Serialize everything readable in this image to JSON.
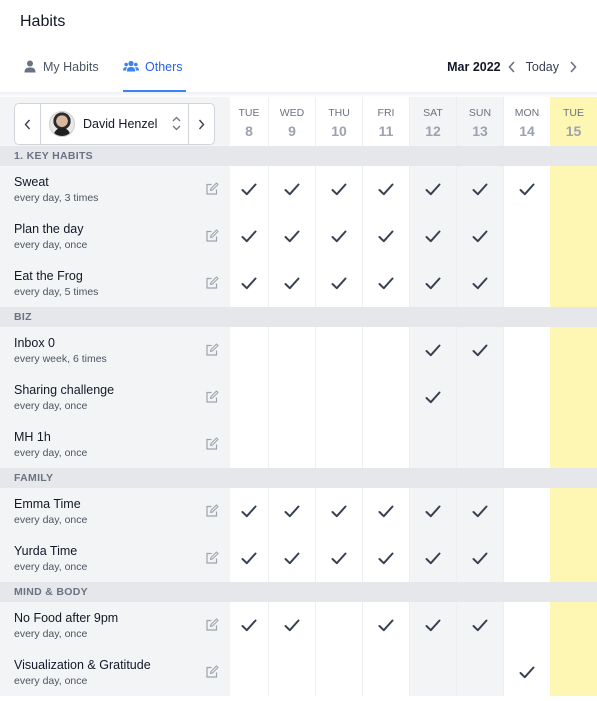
{
  "app": {
    "title": "Habits"
  },
  "tabs": [
    {
      "label": "My Habits",
      "icon": "user-icon",
      "active": false
    },
    {
      "label": "Others",
      "icon": "users-icon",
      "active": true
    }
  ],
  "date_nav": {
    "month": "Mar 2022",
    "today_label": "Today"
  },
  "person_picker": {
    "name": "David Henzel"
  },
  "days": [
    {
      "dow": "TUE",
      "num": "8",
      "weekend": false,
      "today": false
    },
    {
      "dow": "WED",
      "num": "9",
      "weekend": false,
      "today": false
    },
    {
      "dow": "THU",
      "num": "10",
      "weekend": false,
      "today": false
    },
    {
      "dow": "FRI",
      "num": "11",
      "weekend": false,
      "today": false
    },
    {
      "dow": "SAT",
      "num": "12",
      "weekend": true,
      "today": false
    },
    {
      "dow": "SUN",
      "num": "13",
      "weekend": true,
      "today": false
    },
    {
      "dow": "MON",
      "num": "14",
      "weekend": false,
      "today": false
    },
    {
      "dow": "TUE",
      "num": "15",
      "weekend": false,
      "today": true
    }
  ],
  "sections": [
    {
      "title": "1. KEY HABITS",
      "habits": [
        {
          "name": "Sweat",
          "freq": "every day, 3 times",
          "checks": [
            1,
            1,
            1,
            1,
            1,
            1,
            1,
            0
          ]
        },
        {
          "name": "Plan the day",
          "freq": "every day, once",
          "checks": [
            1,
            1,
            1,
            1,
            1,
            1,
            0,
            0
          ]
        },
        {
          "name": "Eat the Frog",
          "freq": "every day, 5 times",
          "checks": [
            1,
            1,
            1,
            1,
            1,
            1,
            0,
            0
          ]
        }
      ]
    },
    {
      "title": "BIZ",
      "habits": [
        {
          "name": "Inbox 0",
          "freq": "every week, 6 times",
          "checks": [
            0,
            0,
            0,
            0,
            1,
            1,
            0,
            0
          ]
        },
        {
          "name": "Sharing challenge",
          "freq": "every day, once",
          "checks": [
            0,
            0,
            0,
            0,
            1,
            0,
            0,
            0
          ]
        },
        {
          "name": "MH 1h",
          "freq": "every day, once",
          "checks": [
            0,
            0,
            0,
            0,
            0,
            0,
            0,
            0
          ]
        }
      ]
    },
    {
      "title": "FAMILY",
      "habits": [
        {
          "name": "Emma Time",
          "freq": "every day, once",
          "checks": [
            1,
            1,
            1,
            1,
            1,
            1,
            0,
            0
          ]
        },
        {
          "name": "Yurda Time",
          "freq": "every day, once",
          "checks": [
            1,
            1,
            1,
            1,
            1,
            1,
            0,
            0
          ]
        }
      ]
    },
    {
      "title": "MIND & BODY",
      "habits": [
        {
          "name": "No Food after 9pm",
          "freq": "every day, once",
          "checks": [
            1,
            1,
            0,
            1,
            1,
            1,
            0,
            0
          ]
        },
        {
          "name": "Visualization & Gratitude",
          "freq": "every day, once",
          "checks": [
            0,
            0,
            0,
            0,
            0,
            0,
            1,
            0
          ]
        }
      ]
    }
  ]
}
